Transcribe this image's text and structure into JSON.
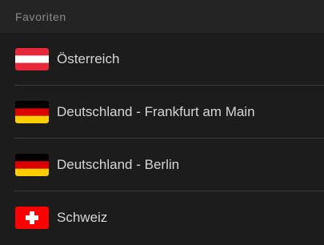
{
  "header": {
    "title": "Favoriten"
  },
  "favorites": [
    {
      "label": "Österreich",
      "flag": "austria-flag"
    },
    {
      "label": "Deutschland - Frankfurt am Main",
      "flag": "germany-flag"
    },
    {
      "label": "Deutschland - Berlin",
      "flag": "germany-flag"
    },
    {
      "label": "Schweiz",
      "flag": "switzerland-flag"
    }
  ],
  "colors": {
    "background": "#1c1c1c",
    "header_background": "#242424",
    "header_text": "#8a8a8a",
    "item_text": "#d6d6d6",
    "divider": "#3a3a3a",
    "austria_red": "#e8283a",
    "germany_black": "#000000",
    "germany_red": "#dd0000",
    "germany_gold": "#ffce00",
    "swiss_red": "#ff0000"
  }
}
